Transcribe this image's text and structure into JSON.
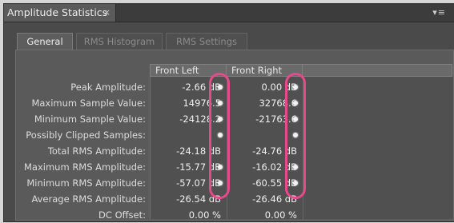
{
  "panel": {
    "title": "Amplitude Statistics",
    "close_glyph": "×",
    "menu_glyph": "▾≡"
  },
  "tabs": [
    {
      "label": "General",
      "active": true
    },
    {
      "label": "RMS Histogram",
      "active": false
    },
    {
      "label": "RMS Settings",
      "active": false
    }
  ],
  "columns": [
    "Front Left",
    "Front Right"
  ],
  "rows": [
    {
      "label": "Peak Amplitude:",
      "left": "-2.66 dB",
      "right": "0.00 dB"
    },
    {
      "label": "Maximum Sample Value:",
      "left": "14976.5",
      "right": "32768.6"
    },
    {
      "label": "Minimum Sample Value:",
      "left": "-24128.2",
      "right": "-21763.6"
    },
    {
      "label": "Possibly Clipped Samples:",
      "left": "",
      "right": ""
    },
    {
      "label": "Total RMS Amplitude:",
      "left": "-24.18 dB",
      "right": "-24.76 dB"
    },
    {
      "label": "Maximum RMS Amplitude:",
      "left": "-15.77 dB",
      "right": "-16.02 dB"
    },
    {
      "label": "Minimum RMS Amplitude:",
      "left": "-57.07 dB",
      "right": "-60.55 dB"
    },
    {
      "label": "Average RMS Amplitude:",
      "left": "-26.54 dB",
      "right": "-26.46 dB"
    },
    {
      "label": "DC Offset:",
      "left": "0.00 %",
      "right": "0.00 %"
    }
  ],
  "colors": {
    "highlight_oval": "#e64a8a",
    "panel_bg": "#4a4a4a"
  }
}
